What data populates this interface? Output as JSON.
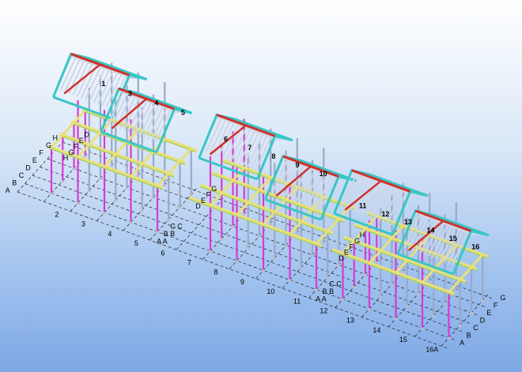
{
  "view": {
    "type": "3D structural steel model viewport",
    "colors": {
      "background_top": "#ffffff",
      "background_bottom": "#7ea8e4",
      "column": "#d63ad6",
      "column_gray": "#9aa8c8",
      "beam_yellow": "#e8e07a",
      "beam_green": "#a8d06a",
      "roof_cyan": "#38c6c6",
      "purlin": "#cfd6e6",
      "ridge_red": "#d0302a",
      "gridline": "#202020"
    }
  },
  "grid_numbers": [
    "1",
    "2",
    "3",
    "4",
    "5",
    "6",
    "7",
    "8",
    "9",
    "10",
    "11",
    "12",
    "13",
    "14",
    "15",
    "16A"
  ],
  "grid_letters": [
    "A",
    "B",
    "C",
    "D",
    "E",
    "F",
    "G",
    "H"
  ],
  "labels": {
    "front_numbers": [
      {
        "text": "2"
      },
      {
        "text": "3"
      },
      {
        "text": "4"
      },
      {
        "text": "5"
      },
      {
        "text": "6"
      },
      {
        "text": "7"
      },
      {
        "text": "8"
      },
      {
        "text": "9"
      },
      {
        "text": "10"
      },
      {
        "text": "11"
      },
      {
        "text": "12"
      },
      {
        "text": "13"
      },
      {
        "text": "14"
      },
      {
        "text": "15"
      },
      {
        "text": "16A"
      }
    ],
    "front_letters_left": [
      {
        "text": "A"
      },
      {
        "text": "B"
      },
      {
        "text": "C"
      },
      {
        "text": "D"
      },
      {
        "text": "E"
      },
      {
        "text": "F"
      },
      {
        "text": "G"
      },
      {
        "text": "H"
      }
    ],
    "mid_pair_1": [
      {
        "text": "C C"
      },
      {
        "text": "B B"
      },
      {
        "text": "A A"
      }
    ],
    "mid_pair_2": [
      {
        "text": "C C"
      },
      {
        "text": "B B"
      },
      {
        "text": "A A"
      }
    ],
    "roof_numbers_left": [
      {
        "text": "1"
      },
      {
        "text": "3"
      },
      {
        "text": "4"
      },
      {
        "text": "5"
      }
    ],
    "roof_numbers_mid": [
      {
        "text": "6"
      },
      {
        "text": "7"
      },
      {
        "text": "8"
      },
      {
        "text": "9"
      },
      {
        "text": "10"
      }
    ],
    "roof_numbers_right": [
      {
        "text": "11"
      },
      {
        "text": "12"
      },
      {
        "text": "13"
      },
      {
        "text": "14"
      },
      {
        "text": "15"
      },
      {
        "text": "16"
      }
    ],
    "right_end_letters": [
      {
        "text": "G"
      },
      {
        "text": "F"
      },
      {
        "text": "E"
      },
      {
        "text": "D"
      },
      {
        "text": "C"
      },
      {
        "text": "B"
      },
      {
        "text": "A"
      }
    ],
    "inner_letters": [
      {
        "text": "H"
      },
      {
        "text": "G"
      },
      {
        "text": "F"
      },
      {
        "text": "E"
      },
      {
        "text": "D"
      },
      {
        "text": "D"
      },
      {
        "text": "E"
      },
      {
        "text": "F"
      },
      {
        "text": "G"
      },
      {
        "text": "D"
      },
      {
        "text": "E"
      },
      {
        "text": "F"
      },
      {
        "text": "G"
      },
      {
        "text": "H"
      }
    ]
  }
}
